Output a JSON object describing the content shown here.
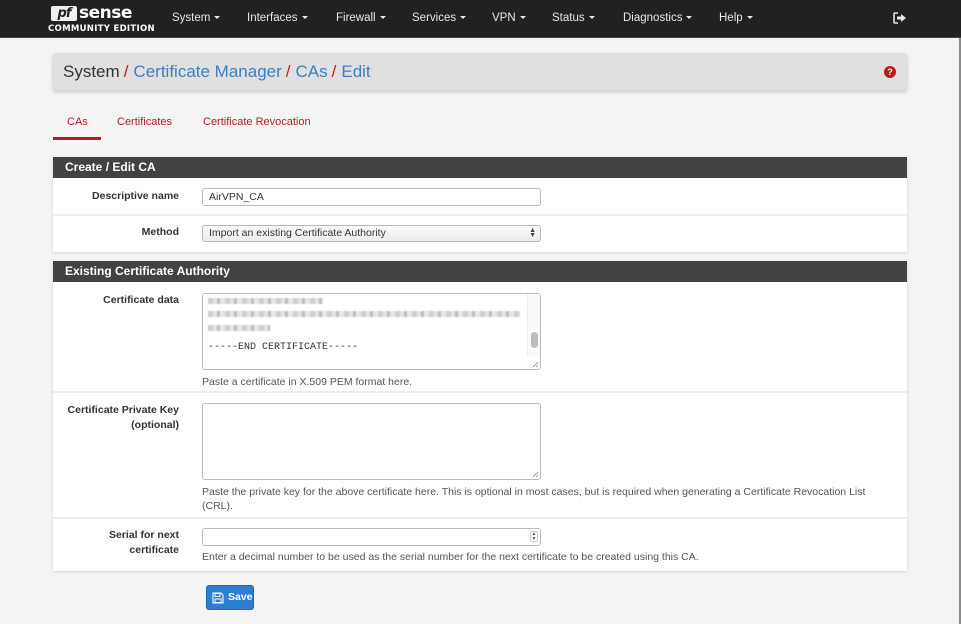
{
  "brand": {
    "logo_pf": "pf",
    "logo_sense": "sense",
    "edition": "COMMUNITY EDITION"
  },
  "nav": {
    "items": [
      {
        "label": "System"
      },
      {
        "label": "Interfaces"
      },
      {
        "label": "Firewall"
      },
      {
        "label": "Services"
      },
      {
        "label": "VPN"
      },
      {
        "label": "Status"
      },
      {
        "label": "Diagnostics"
      },
      {
        "label": "Help"
      }
    ],
    "logout_icon": "sign-out-icon"
  },
  "breadcrumb": {
    "items": [
      {
        "label": "System",
        "link": false
      },
      {
        "label": "Certificate Manager",
        "link": true
      },
      {
        "label": "CAs",
        "link": true
      },
      {
        "label": "Edit",
        "link": true
      }
    ],
    "separator": "/",
    "help_icon": "question-circle-icon"
  },
  "tabs": [
    {
      "label": "CAs",
      "active": true
    },
    {
      "label": "Certificates",
      "active": false
    },
    {
      "label": "Certificate Revocation",
      "active": false
    }
  ],
  "create_edit_panel": {
    "title": "Create / Edit CA",
    "descriptive_name": {
      "label": "Descriptive name",
      "value": "AirVPN_CA"
    },
    "method": {
      "label": "Method",
      "selected": "Import an existing Certificate Authority"
    }
  },
  "existing_ca_panel": {
    "title": "Existing Certificate Authority",
    "certificate_data": {
      "label": "Certificate data",
      "visible_text_end": "-----END CERTIFICATE-----",
      "help": "Paste a certificate in X.509 PEM format here."
    },
    "private_key": {
      "label_line1": "Certificate Private Key",
      "label_line2": "(optional)",
      "value": "",
      "help_line1": "Paste the private key for the above certificate here. This is optional in most cases, but is required when generating a Certificate Revocation List",
      "help_line2": "(CRL)."
    },
    "serial": {
      "label_line1": "Serial for next",
      "label_line2": "certificate",
      "value": "",
      "help": "Enter a decimal number to be used as the serial number for the next certificate to be created using this CA."
    }
  },
  "save_button": {
    "label": "Save",
    "icon": "floppy-disk-icon"
  },
  "colors": {
    "navbar_bg": "#212121",
    "accent_red": "#b31e24",
    "link_blue": "#3a7fc1",
    "panel_heading_bg": "#424242",
    "primary_button": "#2c7ed0",
    "page_bg": "#f4f4f4"
  }
}
